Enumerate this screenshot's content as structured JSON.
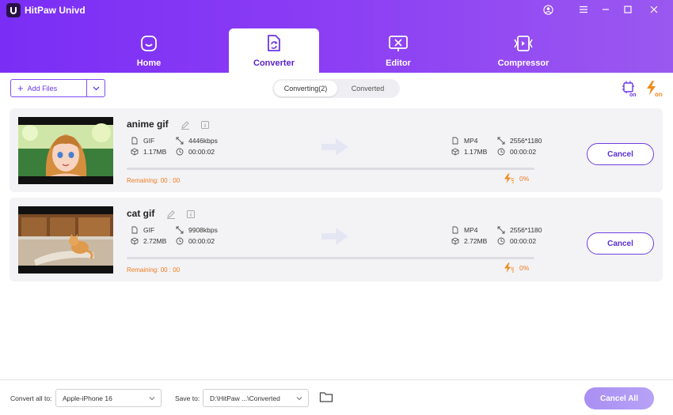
{
  "app": {
    "title": "HitPaw Univd"
  },
  "nav": {
    "tabs": [
      {
        "label": "Home",
        "icon": "home-icon"
      },
      {
        "label": "Converter",
        "icon": "converter-icon",
        "active": true
      },
      {
        "label": "Editor",
        "icon": "editor-icon"
      },
      {
        "label": "Compressor",
        "icon": "compressor-icon"
      }
    ]
  },
  "toolbar": {
    "add_files_label": "Add Files",
    "segments": [
      {
        "label": "Converting(2)",
        "active": true
      },
      {
        "label": "Converted",
        "active": false
      }
    ]
  },
  "files": [
    {
      "name": "anime gif",
      "source": {
        "format": "GIF",
        "bitrate": "4446kbps",
        "size": "1.17MB",
        "duration": "00:00:02"
      },
      "target": {
        "format": "MP4",
        "resolution": "2556*1180",
        "size": "1.17MB",
        "duration": "00:00:02"
      },
      "remaining": "Remaining: 00 : 00",
      "percent": "0%",
      "progress": 0,
      "cancel_label": "Cancel"
    },
    {
      "name": "cat gif",
      "source": {
        "format": "GIF",
        "bitrate": "9908kbps",
        "size": "2.72MB",
        "duration": "00:00:02"
      },
      "target": {
        "format": "MP4",
        "resolution": "2556*1180",
        "size": "2.72MB",
        "duration": "00:00:02"
      },
      "remaining": "Remaining: 00 : 00",
      "percent": "0%",
      "progress": 0,
      "cancel_label": "Cancel"
    }
  ],
  "footer": {
    "convert_all_label": "Convert all to:",
    "convert_all_value": "Apple-iPhone 16",
    "save_to_label": "Save to:",
    "save_to_value": "D:\\HitPaw ...\\Converted",
    "cancel_all_label": "Cancel All"
  },
  "colors": {
    "accent": "#7a2ef5",
    "warning": "#ef7b1f",
    "card_bg": "#f3f3f5"
  }
}
